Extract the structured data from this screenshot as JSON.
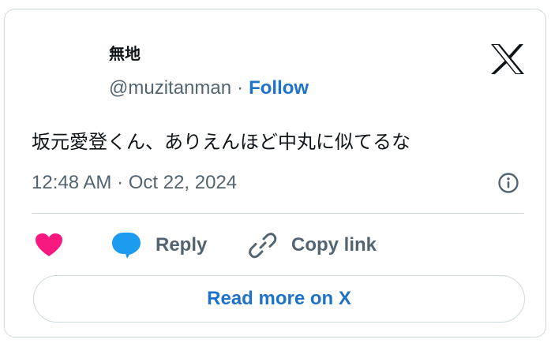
{
  "author": {
    "name": "無地",
    "handle": "@muzitanman",
    "separator": "·",
    "follow_label": "Follow"
  },
  "tweet": {
    "text": "坂元愛登くん、ありえんほど中丸に似てるな",
    "timestamp": "12:48 AM · Oct 22, 2024"
  },
  "actions": {
    "reply_label": "Reply",
    "copy_link_label": "Copy link"
  },
  "read_more_label": "Read more on X",
  "icons": {
    "logo": "x-logo-icon",
    "info": "info-icon",
    "like": "heart-icon",
    "reply": "speech-bubble-icon",
    "copy": "link-icon"
  },
  "colors": {
    "heart": "#f91880",
    "reply": "#1d9bf0",
    "link": "#1d72c9",
    "muted": "#536471",
    "text": "#0f1419",
    "border": "#cfd9de"
  }
}
